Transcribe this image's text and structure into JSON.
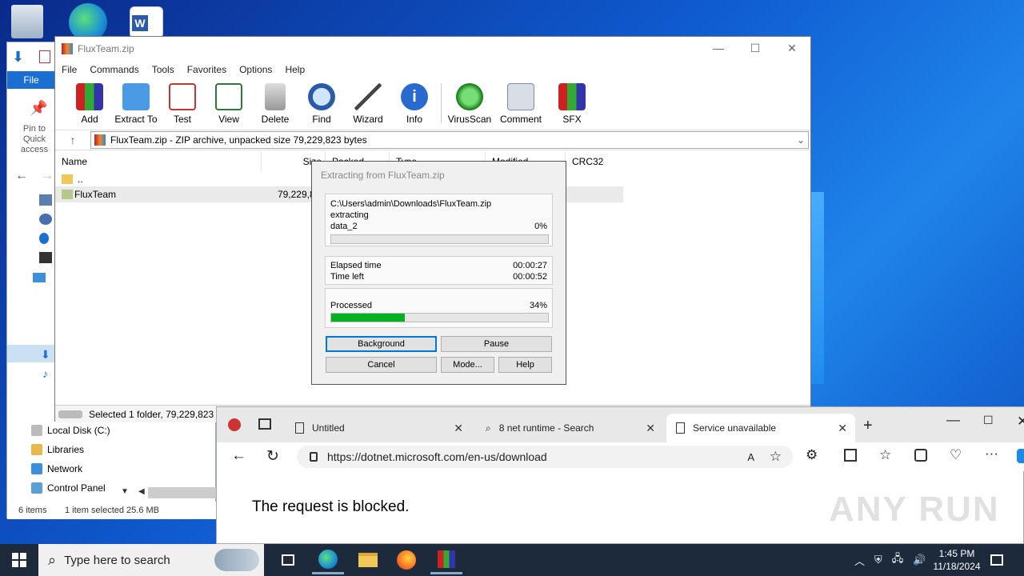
{
  "explorer": {
    "file_tab": "File",
    "pin_label": "Pin to Quick access",
    "tree": [
      "Local Disk (C:)",
      "Libraries",
      "Network",
      "Control Panel"
    ],
    "status_items": "6 items",
    "status_selected": "1 item selected  25.6 MB"
  },
  "winrar": {
    "title": "FluxTeam.zip",
    "menu": [
      "File",
      "Commands",
      "Tools",
      "Favorites",
      "Options",
      "Help"
    ],
    "toolbar": [
      "Add",
      "Extract To",
      "Test",
      "View",
      "Delete",
      "Find",
      "Wizard",
      "Info",
      "VirusScan",
      "Comment",
      "SFX"
    ],
    "address": "FluxTeam.zip - ZIP archive, unpacked size 79,229,823 bytes",
    "columns": [
      "Name",
      "Size",
      "Packed",
      "Type",
      "Modified",
      "CRC32"
    ],
    "rows": [
      {
        "name": "..",
        "size": ""
      },
      {
        "name": "FluxTeam",
        "size": "79,229,823"
      }
    ],
    "status": "Selected 1 folder, 79,229,823 b"
  },
  "dialog": {
    "title": "Extracting from FluxTeam.zip",
    "path": "C:\\Users\\admin\\Downloads\\FluxTeam.zip",
    "action": "extracting",
    "file": "data_2",
    "file_percent": "0%",
    "file_progress": 0,
    "elapsed_label": "Elapsed time",
    "elapsed": "00:00:27",
    "left_label": "Time left",
    "left": "00:00:52",
    "processed_label": "Processed",
    "processed": "34%",
    "processed_progress": 0.34,
    "buttons": {
      "background": "Background",
      "pause": "Pause",
      "cancel": "Cancel",
      "mode": "Mode...",
      "help": "Help"
    }
  },
  "edge": {
    "tabs": [
      "Untitled",
      "8 net runtime - Search",
      "Service unavailable"
    ],
    "url": "https://dotnet.microsoft.com/en-us/download",
    "message": "The request is blocked."
  },
  "taskbar": {
    "search_placeholder": "Type here to search",
    "time": "1:45 PM",
    "date": "11/18/2024"
  },
  "watermark": "ANY RUN",
  "colors": {
    "progress": "#06b025",
    "explorer_accent": "#1a6fd1",
    "taskbar": "#1c2a3c"
  }
}
